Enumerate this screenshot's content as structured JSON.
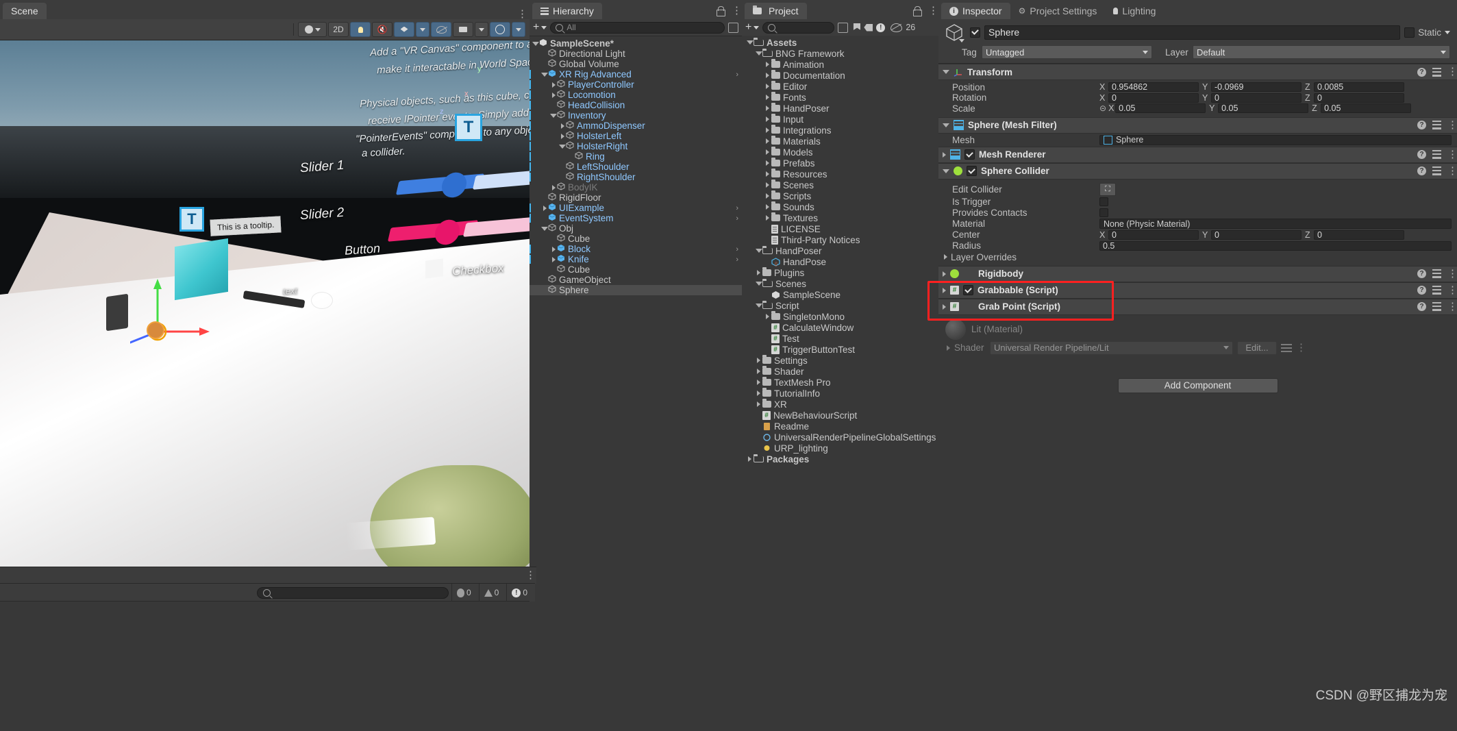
{
  "scene": {
    "tab_label": "Scene",
    "toolbar": {
      "shading_label": "Shaded",
      "two_d_label": "2D",
      "lighting_icon": "lightbulb-icon",
      "audio_icon": "audio-mute-icon",
      "fx_icon": "effects-icon",
      "visibility_icon": "scene-visibility-icon",
      "camera_icon": "scene-camera-icon",
      "gizmos_icon": "gizmos-icon"
    },
    "annotations": [
      "Add a \"VR Canvas\" component to any",
      "make it interactable in World Space.",
      "Physical objects, such as this cube, can als",
      "receive IPointer events. Simply add a",
      "\"PointerEvents\" component to any object that",
      "a collider."
    ],
    "labels": {
      "slider1": "Slider 1",
      "slider2": "Slider 2",
      "button": "Button",
      "checkbox": "Checkbox",
      "text": "text",
      "tooltip": "This is a tooltip."
    },
    "gizmo_axes": [
      "x",
      "y",
      "z"
    ],
    "status_dots": "more-options-icon"
  },
  "console": {
    "search_placeholder": "",
    "log_count": "0",
    "warning_count": "0",
    "error_count": "0"
  },
  "hierarchy": {
    "tab_label": "Hierarchy",
    "search_placeholder": "All",
    "plus_label": "+",
    "items": [
      {
        "label": "SampleScene*",
        "depth": 0,
        "icon": "unity-scene-icon",
        "expand": "open",
        "bold": true
      },
      {
        "label": "Directional Light",
        "depth": 1,
        "icon": "gameobject-icon",
        "expand": "none"
      },
      {
        "label": "Global Volume",
        "depth": 1,
        "icon": "gameobject-icon",
        "expand": "none"
      },
      {
        "label": "XR Rig Advanced",
        "depth": 1,
        "icon": "prefab-icon",
        "expand": "open",
        "prefab": true,
        "chevron": true
      },
      {
        "label": "PlayerController",
        "depth": 2,
        "icon": "gameobject-icon",
        "expand": "closed",
        "prefab": true
      },
      {
        "label": "Locomotion",
        "depth": 2,
        "icon": "gameobject-icon",
        "expand": "closed",
        "prefab": true
      },
      {
        "label": "HeadCollision",
        "depth": 2,
        "icon": "gameobject-icon",
        "expand": "none",
        "prefab": true
      },
      {
        "label": "Inventory",
        "depth": 2,
        "icon": "gameobject-icon",
        "expand": "open",
        "prefab": true
      },
      {
        "label": "AmmoDispenser",
        "depth": 3,
        "icon": "gameobject-icon",
        "expand": "closed",
        "prefab": true
      },
      {
        "label": "HolsterLeft",
        "depth": 3,
        "icon": "gameobject-icon",
        "expand": "closed",
        "prefab": true
      },
      {
        "label": "HolsterRight",
        "depth": 3,
        "icon": "gameobject-icon",
        "expand": "open",
        "prefab": true
      },
      {
        "label": "Ring",
        "depth": 4,
        "icon": "gameobject-icon",
        "expand": "none",
        "prefab": true
      },
      {
        "label": "LeftShoulder",
        "depth": 3,
        "icon": "gameobject-icon",
        "expand": "none",
        "prefab": true
      },
      {
        "label": "RightShoulder",
        "depth": 3,
        "icon": "gameobject-icon",
        "expand": "none",
        "prefab": true
      },
      {
        "label": "BodyIK",
        "depth": 2,
        "icon": "gameobject-icon",
        "expand": "closed",
        "dim": true
      },
      {
        "label": "RigidFloor",
        "depth": 1,
        "icon": "gameobject-icon",
        "expand": "none"
      },
      {
        "label": "UIExample",
        "depth": 1,
        "icon": "prefab-icon",
        "expand": "closed",
        "prefab": true,
        "chevron": true
      },
      {
        "label": "EventSystem",
        "depth": 1,
        "icon": "prefab-icon",
        "expand": "none",
        "prefab": true,
        "chevron": true
      },
      {
        "label": "Obj",
        "depth": 1,
        "icon": "gameobject-icon",
        "expand": "open"
      },
      {
        "label": "Cube",
        "depth": 2,
        "icon": "gameobject-icon",
        "expand": "none"
      },
      {
        "label": "Block",
        "depth": 2,
        "icon": "prefab-icon",
        "expand": "closed",
        "prefab": true,
        "chevron": true
      },
      {
        "label": "Knife",
        "depth": 2,
        "icon": "prefab-icon",
        "expand": "closed",
        "prefab": true,
        "chevron": true
      },
      {
        "label": "Cube",
        "depth": 2,
        "icon": "gameobject-icon",
        "expand": "none"
      },
      {
        "label": "GameObject",
        "depth": 1,
        "icon": "gameobject-icon",
        "expand": "none"
      },
      {
        "label": "Sphere",
        "depth": 1,
        "icon": "gameobject-icon",
        "expand": "none",
        "selected": true
      }
    ]
  },
  "project": {
    "tab_label": "Project",
    "search_placeholder": "",
    "plus_label": "+",
    "hidden_count": "26",
    "toolbar_icons": [
      "favorite-icon",
      "label-icon",
      "error-filter-icon",
      "hidden-packages-icon"
    ],
    "items": [
      {
        "label": "Assets",
        "depth": 0,
        "icon": "folder-open-icon",
        "expand": "open",
        "bold": true
      },
      {
        "label": "BNG Framework",
        "depth": 1,
        "icon": "folder-open-icon",
        "expand": "open"
      },
      {
        "label": "Animation",
        "depth": 2,
        "icon": "folder-icon",
        "expand": "closed"
      },
      {
        "label": "Documentation",
        "depth": 2,
        "icon": "folder-icon",
        "expand": "closed"
      },
      {
        "label": "Editor",
        "depth": 2,
        "icon": "folder-icon",
        "expand": "closed"
      },
      {
        "label": "Fonts",
        "depth": 2,
        "icon": "folder-icon",
        "expand": "closed"
      },
      {
        "label": "HandPoser",
        "depth": 2,
        "icon": "folder-icon",
        "expand": "closed"
      },
      {
        "label": "Input",
        "depth": 2,
        "icon": "folder-icon",
        "expand": "closed"
      },
      {
        "label": "Integrations",
        "depth": 2,
        "icon": "folder-icon",
        "expand": "closed"
      },
      {
        "label": "Materials",
        "depth": 2,
        "icon": "folder-icon",
        "expand": "closed"
      },
      {
        "label": "Models",
        "depth": 2,
        "icon": "folder-icon",
        "expand": "closed"
      },
      {
        "label": "Prefabs",
        "depth": 2,
        "icon": "folder-icon",
        "expand": "closed"
      },
      {
        "label": "Resources",
        "depth": 2,
        "icon": "folder-icon",
        "expand": "closed"
      },
      {
        "label": "Scenes",
        "depth": 2,
        "icon": "folder-icon",
        "expand": "closed"
      },
      {
        "label": "Scripts",
        "depth": 2,
        "icon": "folder-icon",
        "expand": "closed"
      },
      {
        "label": "Sounds",
        "depth": 2,
        "icon": "folder-icon",
        "expand": "closed"
      },
      {
        "label": "Textures",
        "depth": 2,
        "icon": "folder-icon",
        "expand": "closed"
      },
      {
        "label": "LICENSE",
        "depth": 2,
        "icon": "text-file-icon",
        "expand": "none"
      },
      {
        "label": "Third-Party Notices",
        "depth": 2,
        "icon": "text-file-icon",
        "expand": "none"
      },
      {
        "label": "HandPoser",
        "depth": 1,
        "icon": "folder-open-icon",
        "expand": "open"
      },
      {
        "label": "HandPose",
        "depth": 2,
        "icon": "handpose-asset-icon",
        "expand": "none"
      },
      {
        "label": "Plugins",
        "depth": 1,
        "icon": "folder-icon",
        "expand": "closed"
      },
      {
        "label": "Scenes",
        "depth": 1,
        "icon": "folder-open-icon",
        "expand": "open"
      },
      {
        "label": "SampleScene",
        "depth": 2,
        "icon": "unity-scene-icon",
        "expand": "none"
      },
      {
        "label": "Script",
        "depth": 1,
        "icon": "folder-open-icon",
        "expand": "open"
      },
      {
        "label": "SingletonMono",
        "depth": 2,
        "icon": "folder-icon",
        "expand": "closed"
      },
      {
        "label": "CalculateWindow",
        "depth": 2,
        "icon": "csharp-script-icon",
        "expand": "none"
      },
      {
        "label": "Test",
        "depth": 2,
        "icon": "csharp-script-icon",
        "expand": "none"
      },
      {
        "label": "TriggerButtonTest",
        "depth": 2,
        "icon": "csharp-script-icon",
        "expand": "none"
      },
      {
        "label": "Settings",
        "depth": 1,
        "icon": "folder-icon",
        "expand": "closed"
      },
      {
        "label": "Shader",
        "depth": 1,
        "icon": "folder-icon",
        "expand": "closed"
      },
      {
        "label": "TextMesh Pro",
        "depth": 1,
        "icon": "folder-icon",
        "expand": "closed"
      },
      {
        "label": "TutorialInfo",
        "depth": 1,
        "icon": "folder-icon",
        "expand": "closed"
      },
      {
        "label": "XR",
        "depth": 1,
        "icon": "folder-icon",
        "expand": "closed"
      },
      {
        "label": "NewBehaviourScript",
        "depth": 1,
        "icon": "csharp-script-icon",
        "expand": "none"
      },
      {
        "label": "Readme",
        "depth": 1,
        "icon": "readme-asset-icon",
        "expand": "none"
      },
      {
        "label": "UniversalRenderPipelineGlobalSettings",
        "depth": 1,
        "icon": "settings-asset-icon",
        "expand": "none"
      },
      {
        "label": "URP_lighting",
        "depth": 1,
        "icon": "lighting-asset-icon",
        "expand": "none"
      },
      {
        "label": "Packages",
        "depth": 0,
        "icon": "folder-open-icon",
        "expand": "closed",
        "bold": true
      }
    ]
  },
  "inspector": {
    "tabs": [
      {
        "label": "Inspector",
        "icon": "info-icon",
        "active": true
      },
      {
        "label": "Project Settings",
        "icon": "gear-icon",
        "active": false
      },
      {
        "label": "Lighting",
        "icon": "lightbulb-icon",
        "active": false
      }
    ],
    "gameobject": {
      "name": "Sphere",
      "enabled": true,
      "static_label": "Static",
      "tag_label": "Tag",
      "tag_value": "Untagged",
      "layer_label": "Layer",
      "layer_value": "Default"
    },
    "transform": {
      "title": "Transform",
      "position_label": "Position",
      "rotation_label": "Rotation",
      "scale_label": "Scale",
      "position": {
        "x": "0.954862",
        "y": "-0.0969",
        "z": "0.0085"
      },
      "rotation": {
        "x": "0",
        "y": "0",
        "z": "0"
      },
      "scale": {
        "x": "0.05",
        "y": "0.05",
        "z": "0.05"
      }
    },
    "mesh_filter": {
      "title": "Sphere (Mesh Filter)",
      "mesh_label": "Mesh",
      "mesh_value": "Sphere"
    },
    "mesh_renderer": {
      "title": "Mesh Renderer",
      "enabled": true
    },
    "sphere_collider": {
      "title": "Sphere Collider",
      "enabled": true,
      "edit_collider_label": "Edit Collider",
      "is_trigger_label": "Is Trigger",
      "is_trigger": false,
      "provides_contacts_label": "Provides Contacts",
      "provides_contacts": false,
      "material_label": "Material",
      "material_value": "None (Physic Material)",
      "center_label": "Center",
      "center": {
        "x": "0",
        "y": "0",
        "z": "0"
      },
      "radius_label": "Radius",
      "radius_value": "0.5",
      "layer_overrides_label": "Layer Overrides"
    },
    "rigidbody": {
      "title": "Rigidbody"
    },
    "highlighted_scripts": [
      {
        "title": "Grabbable (Script)",
        "enabled": true,
        "has_checkbox": true
      },
      {
        "title": "Grab Point (Script)",
        "enabled": false,
        "has_checkbox": false
      }
    ],
    "material_section": {
      "title": "Lit (Material)",
      "shader_label": "Shader",
      "shader_value": "Universal Render Pipeline/Lit",
      "edit_label": "Edit..."
    },
    "add_component_label": "Add Component",
    "highlight_color": "#ff2020"
  },
  "watermark": "CSDN @野区捕龙为宠"
}
